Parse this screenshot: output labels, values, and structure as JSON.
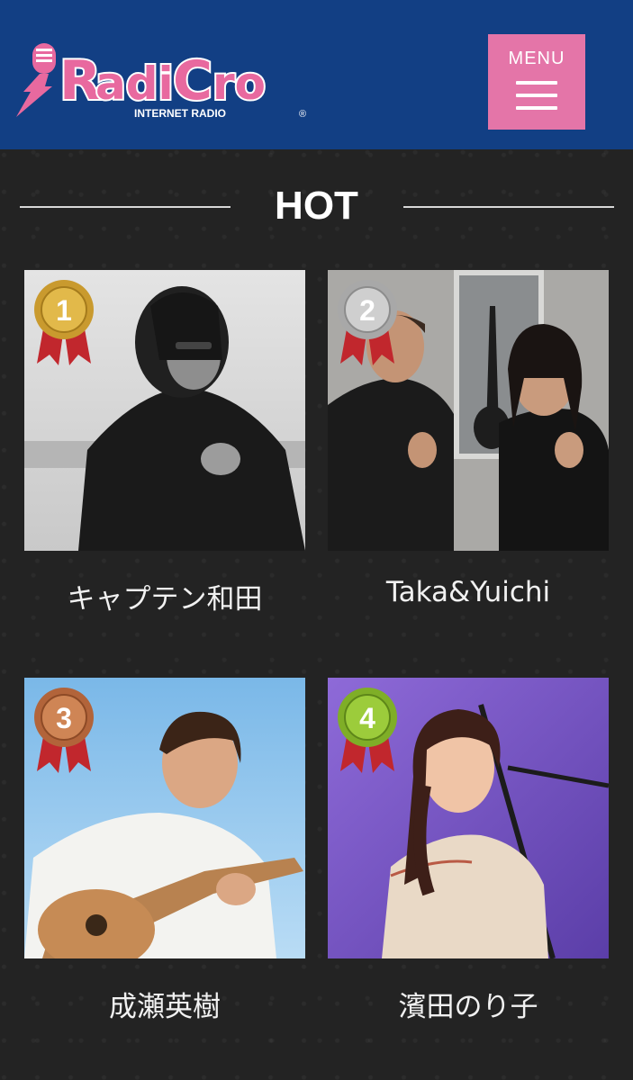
{
  "header": {
    "logo_text": "RadiCro",
    "logo_subtext": "INTERNET RADIO",
    "logo_mark": "®",
    "menu_label": "MENU"
  },
  "section": {
    "title": "HOT"
  },
  "rankings": [
    {
      "rank": "1",
      "name": "キャプテン和田",
      "medal": "gold",
      "medal_color": "#c99a2e",
      "photo": "monochrome portrait of a man in dark coat making a rock hand sign"
    },
    {
      "rank": "2",
      "name": "Taka&Yuichi",
      "medal": "silver",
      "medal_color": "#a8a8a8",
      "photo": "two men in black t-shirts making rock hand signs in a studio"
    },
    {
      "rank": "3",
      "name": "成瀬英樹",
      "medal": "bronze",
      "medal_color": "#b2643a",
      "photo": "smiling man in white shirt playing acoustic guitar under blue sky"
    },
    {
      "rank": "4",
      "name": "濱田のり子",
      "medal": "green",
      "medal_color": "#7fae27",
      "photo": "woman with long hair in patterned blouse on purple-lit stage"
    }
  ],
  "colors": {
    "header_bg": "#123f84",
    "menu_bg": "#e475a8",
    "logo_pink": "#e8699f",
    "page_bg": "#232323"
  }
}
